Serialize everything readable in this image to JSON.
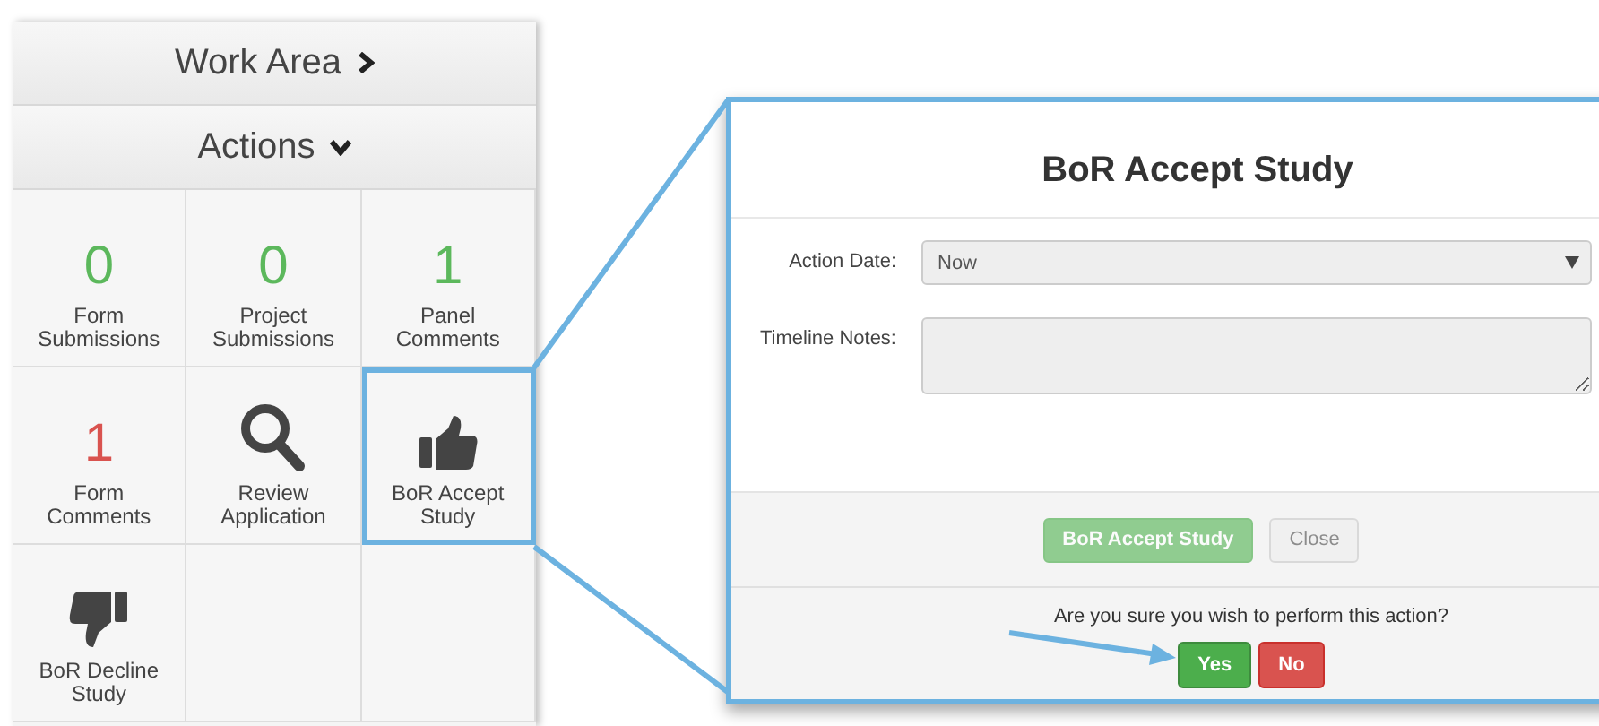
{
  "sidebar": {
    "header": {
      "label": "Work Area"
    },
    "section": {
      "label": "Actions",
      "expanded": true
    },
    "tiles": [
      {
        "kind": "count",
        "count": "0",
        "color": "#5cb85c",
        "label": "Form Submissions",
        "highlighted": false
      },
      {
        "kind": "count",
        "count": "0",
        "color": "#5cb85c",
        "label": "Project Submissions",
        "highlighted": false
      },
      {
        "kind": "count",
        "count": "1",
        "color": "#5cb85c",
        "label": "Panel Comments",
        "highlighted": false
      },
      {
        "kind": "count",
        "count": "1",
        "color": "#d9534f",
        "label": "Form Comments",
        "highlighted": false
      },
      {
        "kind": "search",
        "label": "Review Application",
        "highlighted": false
      },
      {
        "kind": "thumbs-up",
        "label": "BoR Accept Study",
        "highlighted": true
      },
      {
        "kind": "thumbs-down",
        "label": "BoR Decline Study",
        "highlighted": false
      },
      {
        "kind": "empty",
        "highlighted": false
      },
      {
        "kind": "empty",
        "highlighted": false
      }
    ]
  },
  "dialog": {
    "title": "BoR Accept Study",
    "fields": [
      {
        "kind": "select",
        "label": "Action Date:",
        "value": "Now"
      },
      {
        "kind": "textarea",
        "label": "Timeline Notes:"
      }
    ],
    "buttons": [
      {
        "kind": "primary",
        "label": "BoR Accept Study",
        "disabled": true
      },
      {
        "kind": "default",
        "label": "Close",
        "disabled": true
      }
    ],
    "confirm": {
      "question": "Are you sure you wish to perform this action?",
      "buttons": [
        {
          "kind": "yes",
          "label": "Yes",
          "disabled": false
        },
        {
          "kind": "no",
          "label": "No",
          "disabled": false
        }
      ]
    }
  }
}
